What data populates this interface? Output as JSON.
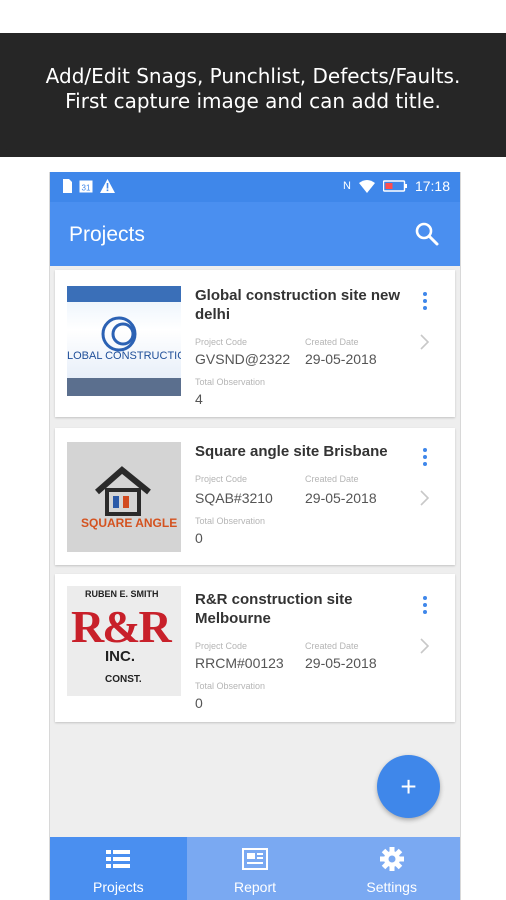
{
  "banner": {
    "line1": "Add/Edit Snags, Punchlist, Defects/Faults.",
    "line2": "First capture image and can add title."
  },
  "statusbar": {
    "time": "17:18",
    "date_icon_text": "31",
    "signal_text": "N"
  },
  "appbar": {
    "title": "Projects"
  },
  "projects": [
    {
      "title": "Global construction site new delhi",
      "code_label": "Project Code",
      "code": "GVSND@2322",
      "date_label": "Created Date",
      "date": "29-05-2018",
      "obs_label": "Total Observation",
      "obs": "4",
      "thumb_text": "LOBAL CONSTRUCTION C"
    },
    {
      "title": "Square angle site Brisbane",
      "code_label": "Project Code",
      "code": "SQAB#3210",
      "date_label": "Created Date",
      "date": "29-05-2018",
      "obs_label": "Total Observation",
      "obs": "0",
      "thumb_text": "SQUARE ANGLE"
    },
    {
      "title": "R&R construction site Melbourne",
      "code_label": "Project Code",
      "code": "RRCM#00123",
      "date_label": "Created Date",
      "date": "29-05-2018",
      "obs_label": "Total Observation",
      "obs": "0",
      "thumb_text": "R&R",
      "thumb_top": "RUBEN E. SMITH",
      "thumb_mid": "INC.",
      "thumb_bottom": "CONST."
    }
  ],
  "fab": {
    "label": "+"
  },
  "bottom_nav": [
    {
      "label": "Projects",
      "icon": "list-icon",
      "active": true
    },
    {
      "label": "Report",
      "icon": "report-icon",
      "active": false
    },
    {
      "label": "Settings",
      "icon": "gear-icon",
      "active": false
    }
  ],
  "colors": {
    "primary": "#4a8ff0",
    "statusbar": "#3f87ea",
    "nav_inactive": "#7aa9f2",
    "banner": "#262626"
  }
}
